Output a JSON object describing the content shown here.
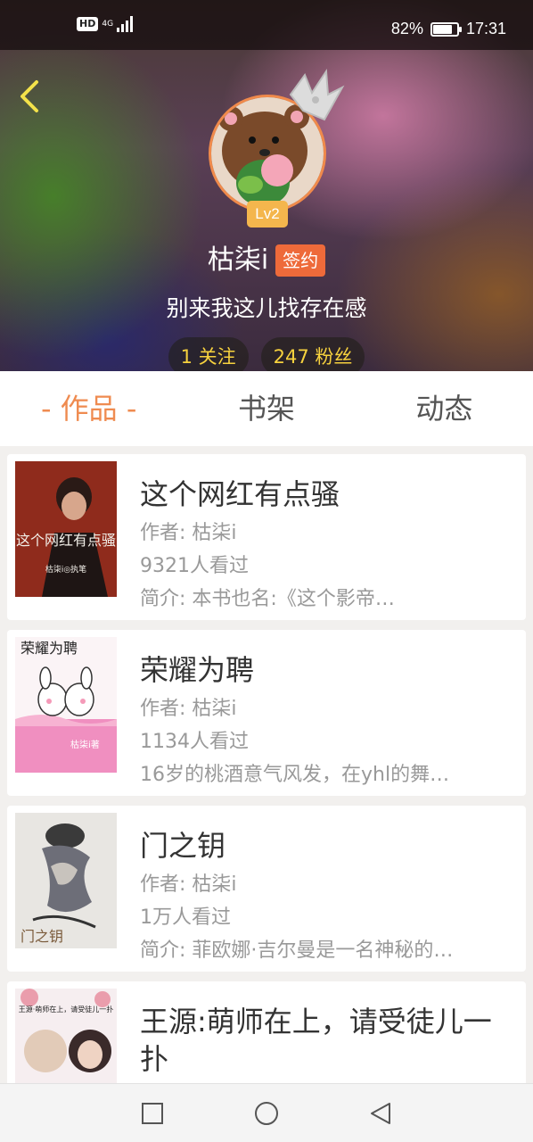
{
  "status_bar": {
    "hd": "HD",
    "network": "4G",
    "battery": "82%",
    "time": "17:31",
    "battery_level": 0.82
  },
  "profile": {
    "level": "Lv2",
    "name": "枯柒i",
    "badge": "签约",
    "bio": "别来我这儿找存在感",
    "following": "1 关注",
    "followers": "247 粉丝"
  },
  "tabs": [
    {
      "label": "- 作品 -",
      "active": true
    },
    {
      "label": "书架",
      "active": false
    },
    {
      "label": "动态",
      "active": false
    }
  ],
  "books": [
    {
      "title": "这个网红有点骚",
      "author": "作者: 枯柒i",
      "views": "9321人看过",
      "intro": "简介: 本书也名:《这个影帝…",
      "cover_text": "这个网红有点骚",
      "cover_sub": "枯柒i◎执笔"
    },
    {
      "title": "荣耀为聘",
      "author": "作者: 枯柒i",
      "views": "1134人看过",
      "intro": "16岁的桃酒意气风发，在yhl的舞…",
      "cover_text": "荣耀为聘",
      "cover_sub": "枯柒i著"
    },
    {
      "title": "门之钥",
      "author": "作者: 枯柒i",
      "views": "1万人看过",
      "intro": "简介: 菲欧娜·吉尔曼是一名神秘的…",
      "cover_text": "门之钥",
      "cover_sub": ""
    },
    {
      "title": "王源:萌师在上，请受徒儿一扑",
      "author": "",
      "views": "",
      "intro": "",
      "cover_text": "王源·萌师在上，请受徒儿一扑",
      "cover_sub": ""
    }
  ],
  "colors": {
    "accent": "#ef8b50",
    "badge": "#ee6a3a",
    "level": "#f4b64d",
    "stat_text": "#f7d23e"
  },
  "icons": {
    "back": "chevron-left-icon",
    "recent": "square-icon",
    "home": "circle-icon",
    "nav_back": "triangle-left-icon"
  }
}
